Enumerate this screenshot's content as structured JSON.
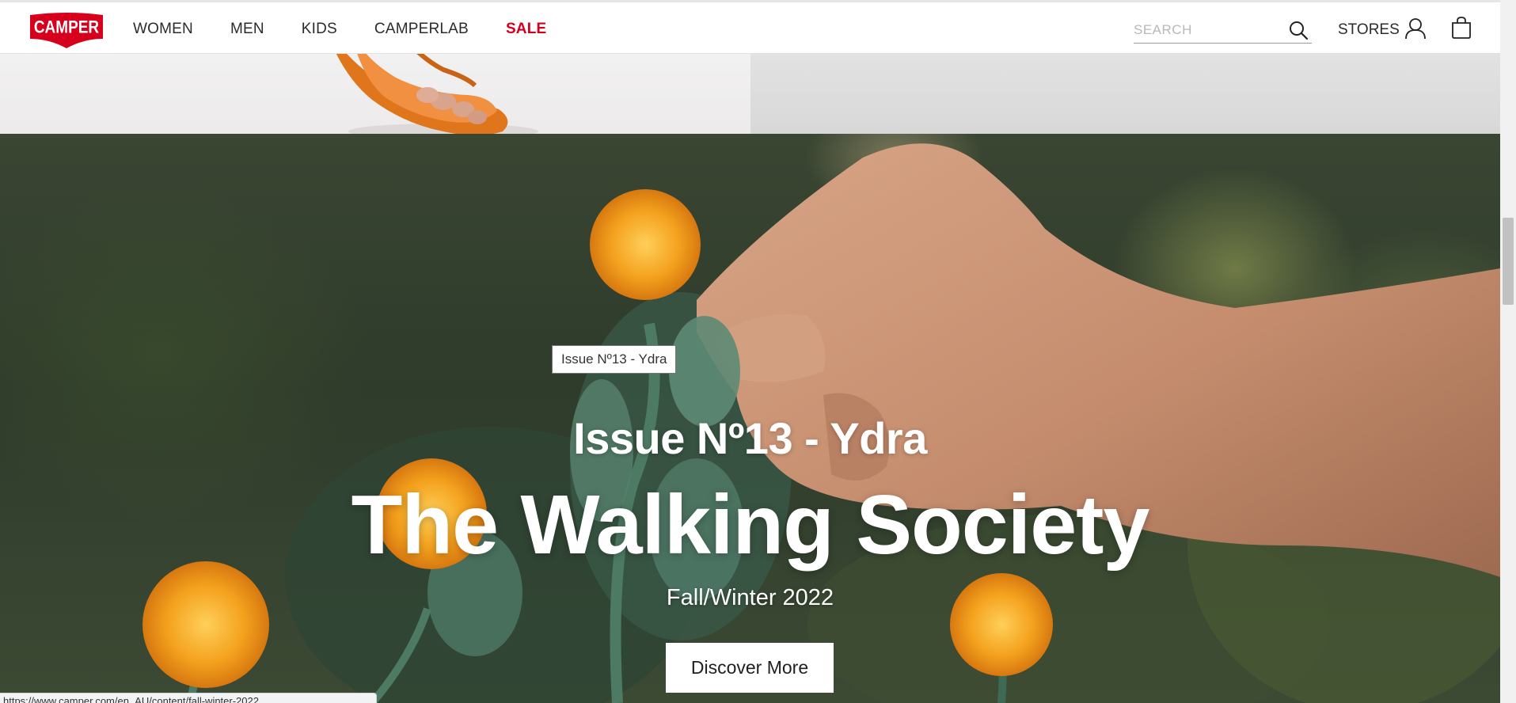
{
  "brand": {
    "logo_text": "CAMPER",
    "color": "#d6001c"
  },
  "nav": {
    "items": [
      {
        "label": "WOMEN"
      },
      {
        "label": "MEN"
      },
      {
        "label": "KIDS"
      },
      {
        "label": "CAMPERLAB"
      },
      {
        "label": "SALE"
      }
    ]
  },
  "header": {
    "search_placeholder": "SEARCH",
    "stores_label": "STORES"
  },
  "hero": {
    "tooltip": "Issue Nº13 - Ydra",
    "issue": "Issue Nº13 - Ydra",
    "title": "The Walking Society",
    "season": "Fall/Winter 2022",
    "cta_label": "Discover More"
  },
  "status_bar": {
    "url": "https://www.camper.com/en_AU/content/fall-winter-2022"
  },
  "icons": {
    "search": "search-icon",
    "user": "user-icon",
    "bag": "shopping-bag-icon"
  }
}
